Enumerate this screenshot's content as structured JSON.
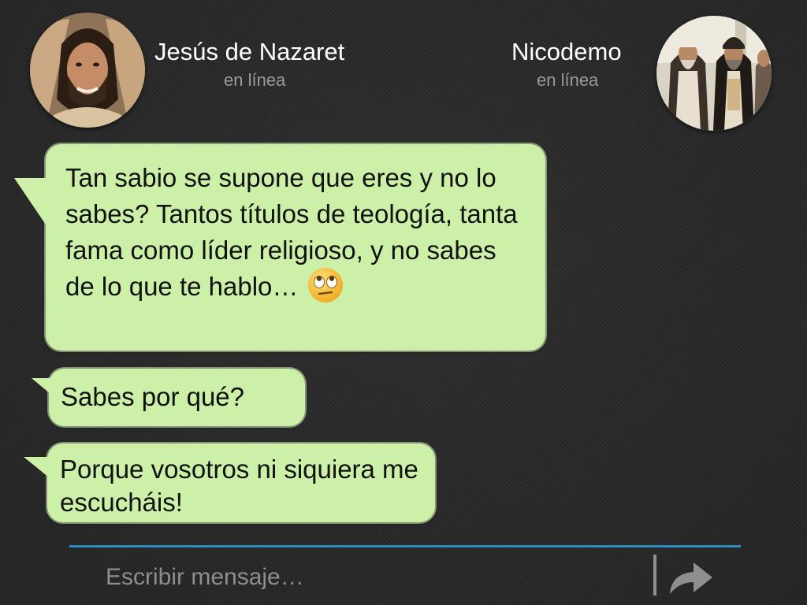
{
  "contacts": {
    "left": {
      "name": "Jesús de Nazaret",
      "status": "en línea"
    },
    "right": {
      "name": "Nicodemo",
      "status": "en línea"
    }
  },
  "messages": [
    {
      "text": "Tan sabio se supone que eres y no lo sabes? Tantos títulos de teología, tanta fama como líder religioso, y no sabes de lo que te hablo…",
      "emoji": "face-with-rolling-eyes"
    },
    {
      "text": "Sabes por qué?"
    },
    {
      "text": "Porque vosotros ni siquiera me escucháis!"
    }
  ],
  "composer": {
    "placeholder": "Escribir mensaje…",
    "send_icon": "send-arrow-icon"
  },
  "colors": {
    "bubble": "#ccf0a8",
    "divider": "#2b8cc4",
    "background": "#2a2a2b",
    "status_text": "#9a9a9a"
  }
}
